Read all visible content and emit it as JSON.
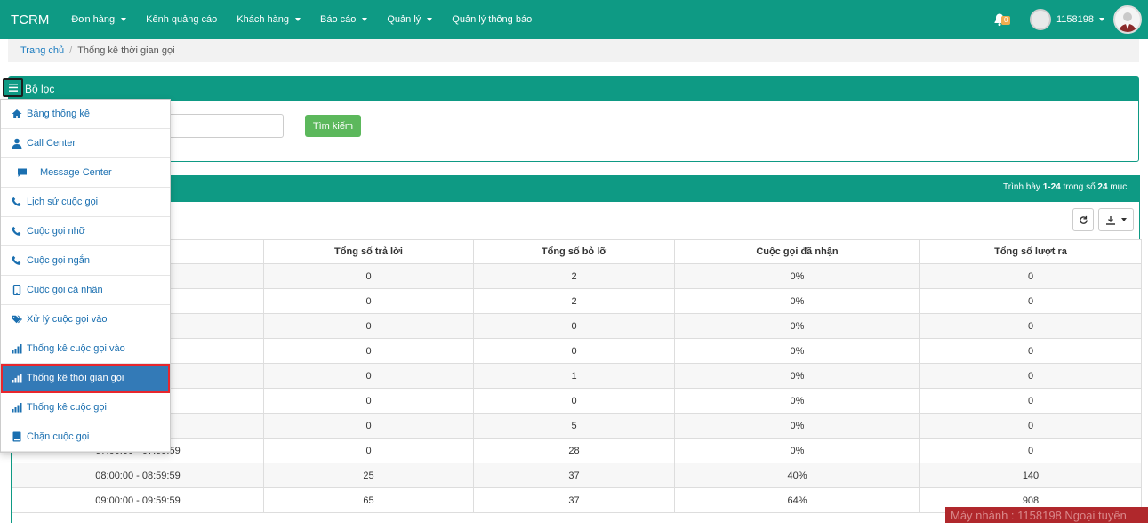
{
  "navbar": {
    "brand": "TCRM",
    "items": [
      {
        "label": "Đơn hàng",
        "dropdown": true
      },
      {
        "label": "Kênh quảng cáo",
        "dropdown": false
      },
      {
        "label": "Khách hàng",
        "dropdown": true
      },
      {
        "label": "Báo cáo",
        "dropdown": true
      },
      {
        "label": "Quản lý",
        "dropdown": true
      },
      {
        "label": "Quản lý thông báo",
        "dropdown": false
      }
    ],
    "notification_count": "0",
    "user_id": "1158198"
  },
  "breadcrumb": {
    "home": "Trang chủ",
    "separator": "/",
    "current": "Thống kê thời gian gọi"
  },
  "filter_panel": {
    "title": "Bộ lọc",
    "search_button": "Tìm kiếm",
    "search_value": ""
  },
  "table_panel": {
    "summary_prefix": "Trình bày ",
    "summary_range": "1-24",
    "summary_mid": " trong số ",
    "summary_total": "24",
    "summary_suffix": " mục."
  },
  "table": {
    "columns": [
      "",
      "Tổng số trả lời",
      "Tổng số bỏ lỡ",
      "Cuộc gọi đã nhận",
      "Tổng số lượt ra"
    ],
    "rows": [
      [
        "59",
        "0",
        "2",
        "0%",
        "0"
      ],
      [
        "59",
        "0",
        "2",
        "0%",
        "0"
      ],
      [
        "59",
        "0",
        "0",
        "0%",
        "0"
      ],
      [
        "59",
        "0",
        "0",
        "0%",
        "0"
      ],
      [
        "59",
        "0",
        "1",
        "0%",
        "0"
      ],
      [
        "59",
        "0",
        "0",
        "0%",
        "0"
      ],
      [
        "59",
        "0",
        "5",
        "0%",
        "0"
      ],
      [
        "07:00:00 - 07:59:59",
        "0",
        "28",
        "0%",
        "0"
      ],
      [
        "08:00:00 - 08:59:59",
        "25",
        "37",
        "40%",
        "140"
      ],
      [
        "09:00:00 - 09:59:59",
        "65",
        "37",
        "64%",
        "908"
      ]
    ]
  },
  "side_menu": {
    "items": [
      {
        "label": "Bảng thống kê",
        "icon": "home-icon"
      },
      {
        "label": "Call Center",
        "icon": "user-icon"
      },
      {
        "label": "Message Center",
        "icon": "message-icon"
      },
      {
        "label": "Lịch sử cuộc gọi",
        "icon": "phone-icon"
      },
      {
        "label": "Cuộc gọi nhỡ",
        "icon": "phone-icon"
      },
      {
        "label": "Cuộc gọi ngắn",
        "icon": "phone-icon"
      },
      {
        "label": "Cuộc gọi cá nhân",
        "icon": "mobile-icon"
      },
      {
        "label": "Xử lý cuộc gọi vào",
        "icon": "tags-icon"
      },
      {
        "label": "Thống kê cuộc gọi vào",
        "icon": "signal-icon"
      },
      {
        "label": "Thống kê thời gian gọi",
        "icon": "signal-icon"
      },
      {
        "label": "Thống kê cuộc gọi",
        "icon": "signal-icon"
      },
      {
        "label": "Chặn cuộc gọi",
        "icon": "book-icon"
      }
    ]
  },
  "status_bar": "Máy nhánh : 1158198 Ngoại tuyến",
  "colors": {
    "primary": "#0e9a84",
    "active": "#337ab7",
    "success": "#5cb85c",
    "link": "#1a7bbf",
    "highlight_border": "#e8262d",
    "badge": "#f0ad4e",
    "status": "#b0282c"
  }
}
